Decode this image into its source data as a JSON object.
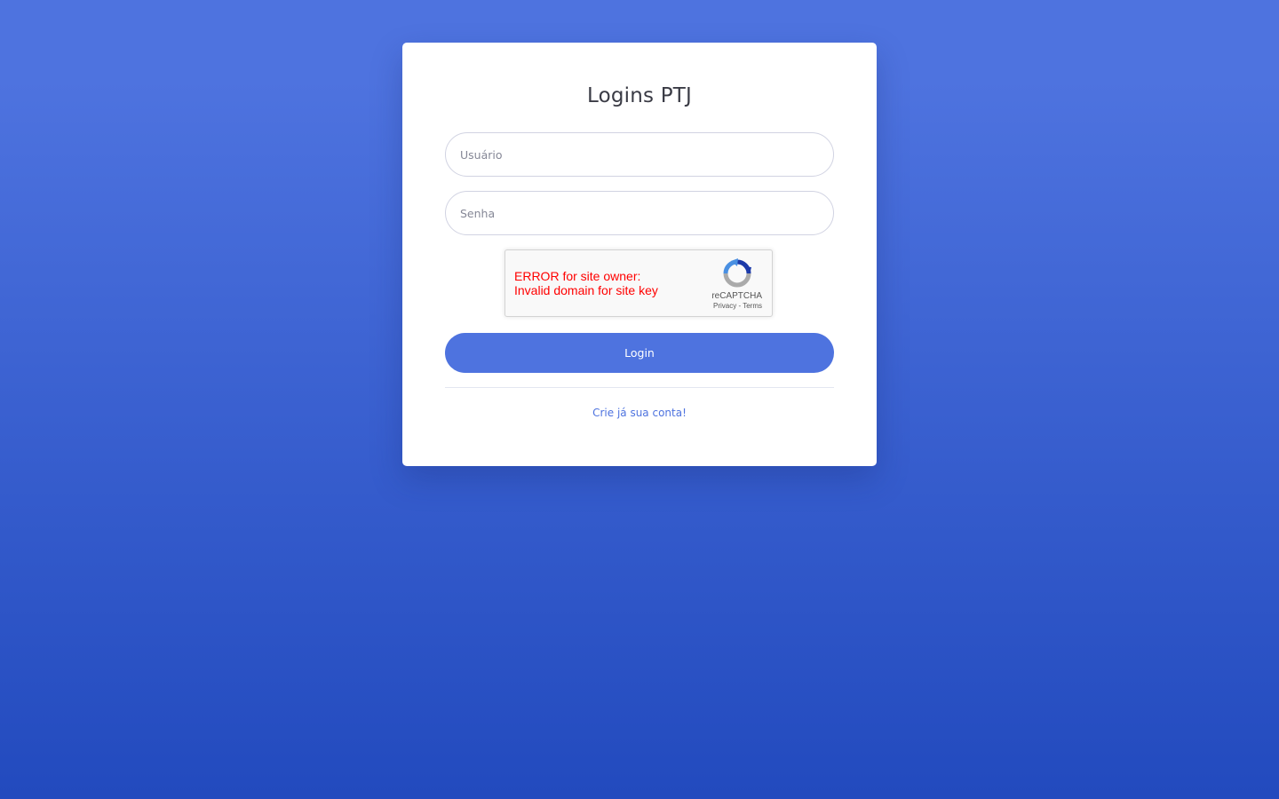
{
  "login": {
    "title": "Logins PTJ",
    "username_placeholder": "Usuário",
    "password_placeholder": "Senha",
    "submit_label": "Login",
    "create_account_label": "Crie já sua conta!"
  },
  "recaptcha": {
    "error_line1": "ERROR for site owner:",
    "error_line2": "Invalid domain for site key",
    "brand": "reCAPTCHA",
    "privacy_label": "Privacy",
    "separator": "-",
    "terms_label": "Terms",
    "icon": "recaptcha-logo-icon"
  },
  "colors": {
    "background_top": "#4e73df",
    "background_bottom": "#224abe",
    "primary": "#4e73df",
    "error": "#ff0000"
  }
}
